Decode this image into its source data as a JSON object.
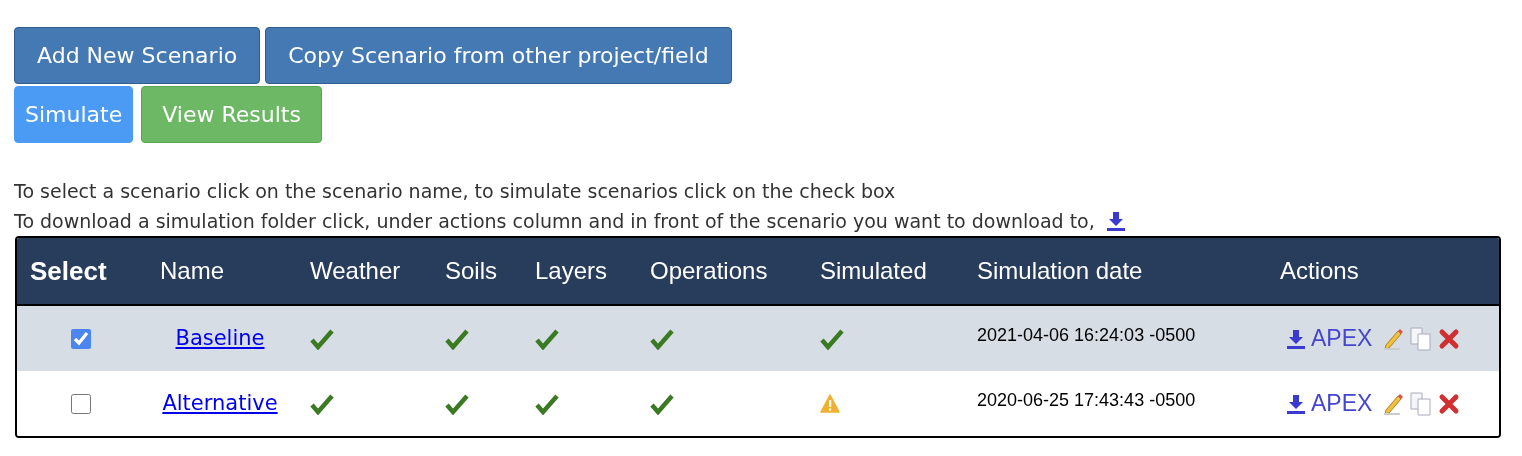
{
  "buttons_top": [
    "Add New Scenario",
    "Copy Scenario from other project/field"
  ],
  "buttons_run": [
    {
      "label": "Simulate",
      "kind": "primary"
    },
    {
      "label": "View Results",
      "kind": "success"
    }
  ],
  "instructions": [
    "To select a scenario click on the scenario name, to simulate scenarios click on the check box",
    "To download a simulation folder click, under actions column and in front of the scenario you want to download to,"
  ],
  "table": {
    "columns": [
      "Select",
      "Name",
      "Weather",
      "Soils",
      "Layers",
      "Operations",
      "Simulated",
      "Simulation date",
      "Actions"
    ],
    "rows": [
      {
        "selected": true,
        "name": "Baseline",
        "weather": {
          "kind": "check"
        },
        "soils": {
          "kind": "check"
        },
        "layers": {
          "kind": "check"
        },
        "operations": {
          "kind": "check"
        },
        "simulated": {
          "kind": "check"
        },
        "date": "2021-04-06 16:24:03 -0500",
        "action_link": "APEX"
      },
      {
        "selected": false,
        "name": "Alternative",
        "weather": {
          "kind": "check"
        },
        "soils": {
          "kind": "check"
        },
        "layers": {
          "kind": "check"
        },
        "operations": {
          "kind": "check"
        },
        "simulated": {
          "kind": "warning"
        },
        "date": "2020-06-25 17:43:43 -0500",
        "action_link": "APEX"
      }
    ]
  }
}
